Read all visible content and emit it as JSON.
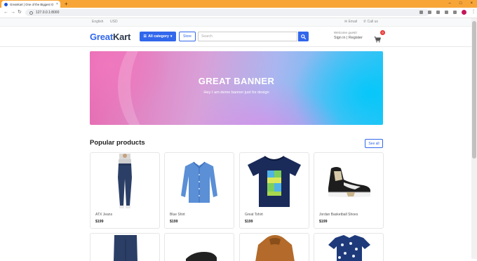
{
  "browser": {
    "tab_title": "GreatKart | One of the Biggest O",
    "tab_close": "×",
    "new_tab": "+",
    "url": "127.0.0.1:8000",
    "win_min": "–",
    "win_max": "□",
    "win_close": "×",
    "back": "←",
    "forward": "→",
    "reload": "↻",
    "menu": "⋮"
  },
  "topbar": {
    "language": "English",
    "currency": "USD",
    "email": "Email",
    "call": "Call us",
    "email_glyph": "✉",
    "call_glyph": "✆"
  },
  "header": {
    "logo_part1": "Great",
    "logo_part2": "Kart",
    "category_label": "All category",
    "category_glyph": "☰",
    "category_caret": "▾",
    "store_label": "Store",
    "search_placeholder": "Search",
    "welcome": "Welcome guest!",
    "sign_in": "Sign in",
    "separator": "|",
    "register": "Register",
    "cart_count": "0"
  },
  "banner": {
    "title": "GREAT BANNER",
    "subtitle": "Hey I am demo banner just for design"
  },
  "products": {
    "section_title": "Popular products",
    "see_all": "See all",
    "items": [
      {
        "name": "ATX Jeans",
        "price": "$199",
        "icon": "jeans-icon"
      },
      {
        "name": "Blue Shirt",
        "price": "$199",
        "icon": "shirt-icon"
      },
      {
        "name": "Great Tshirt",
        "price": "$199",
        "icon": "tshirt-icon"
      },
      {
        "name": "Jordan Basketball Shoes",
        "price": "$199",
        "icon": "sneaker-icon"
      }
    ],
    "next_row_icons": [
      "jeans-icon",
      "shoe-icon",
      "jacket-icon",
      "printed-shirt-icon"
    ]
  },
  "colors": {
    "brand": "#3167eb",
    "chrome_tab_bar": "#f8a538",
    "cart_badge": "#e53935"
  }
}
